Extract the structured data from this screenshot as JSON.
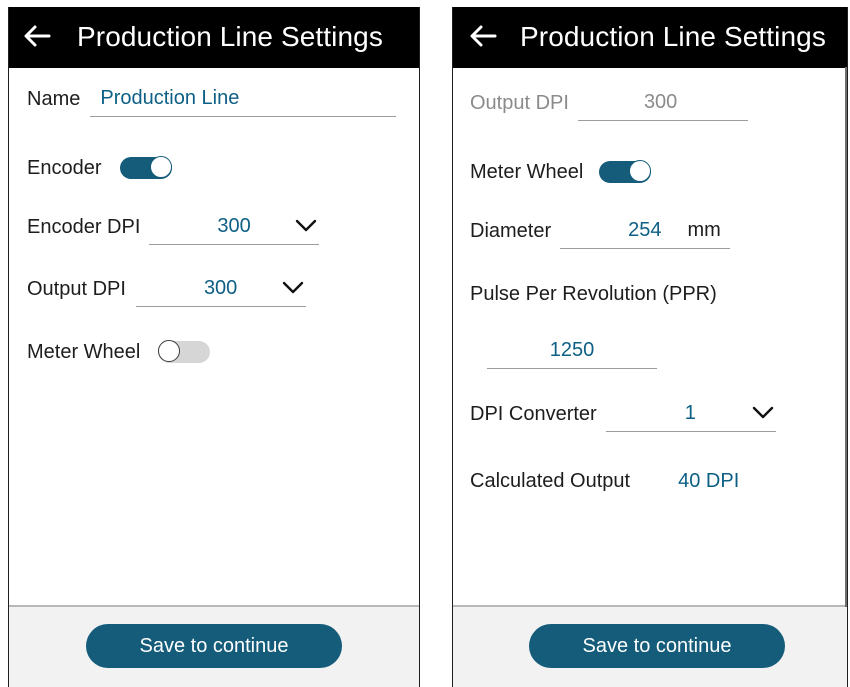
{
  "left_screen": {
    "title": "Production Line Settings",
    "name_label": "Name",
    "name_value": "Production Line",
    "encoder_label": "Encoder",
    "encoder_enabled": true,
    "encoder_dpi_label": "Encoder DPI",
    "encoder_dpi_value": "300",
    "output_dpi_label": "Output DPI",
    "output_dpi_value": "300",
    "meter_wheel_label": "Meter Wheel",
    "meter_wheel_enabled": false,
    "save_label": "Save to continue"
  },
  "right_screen": {
    "title": "Production Line Settings",
    "output_dpi_label": "Output DPI",
    "output_dpi_value": "300",
    "meter_wheel_label": "Meter Wheel",
    "meter_wheel_enabled": true,
    "diameter_label": "Diameter",
    "diameter_value": "254",
    "diameter_unit": "mm",
    "ppr_label": "Pulse Per Revolution (PPR)",
    "ppr_value": "1250",
    "dpi_converter_label": "DPI Converter",
    "dpi_converter_value": "1",
    "calculated_output_label": "Calculated Output",
    "calculated_output_value": "40 DPI",
    "save_label": "Save to continue"
  },
  "colors": {
    "accent": "#145c7a",
    "value_text": "#0d5f86",
    "app_bar": "#000000",
    "footer": "#f2f2f2"
  },
  "icons": [
    "back-arrow-icon",
    "chevron-down-icon"
  ]
}
